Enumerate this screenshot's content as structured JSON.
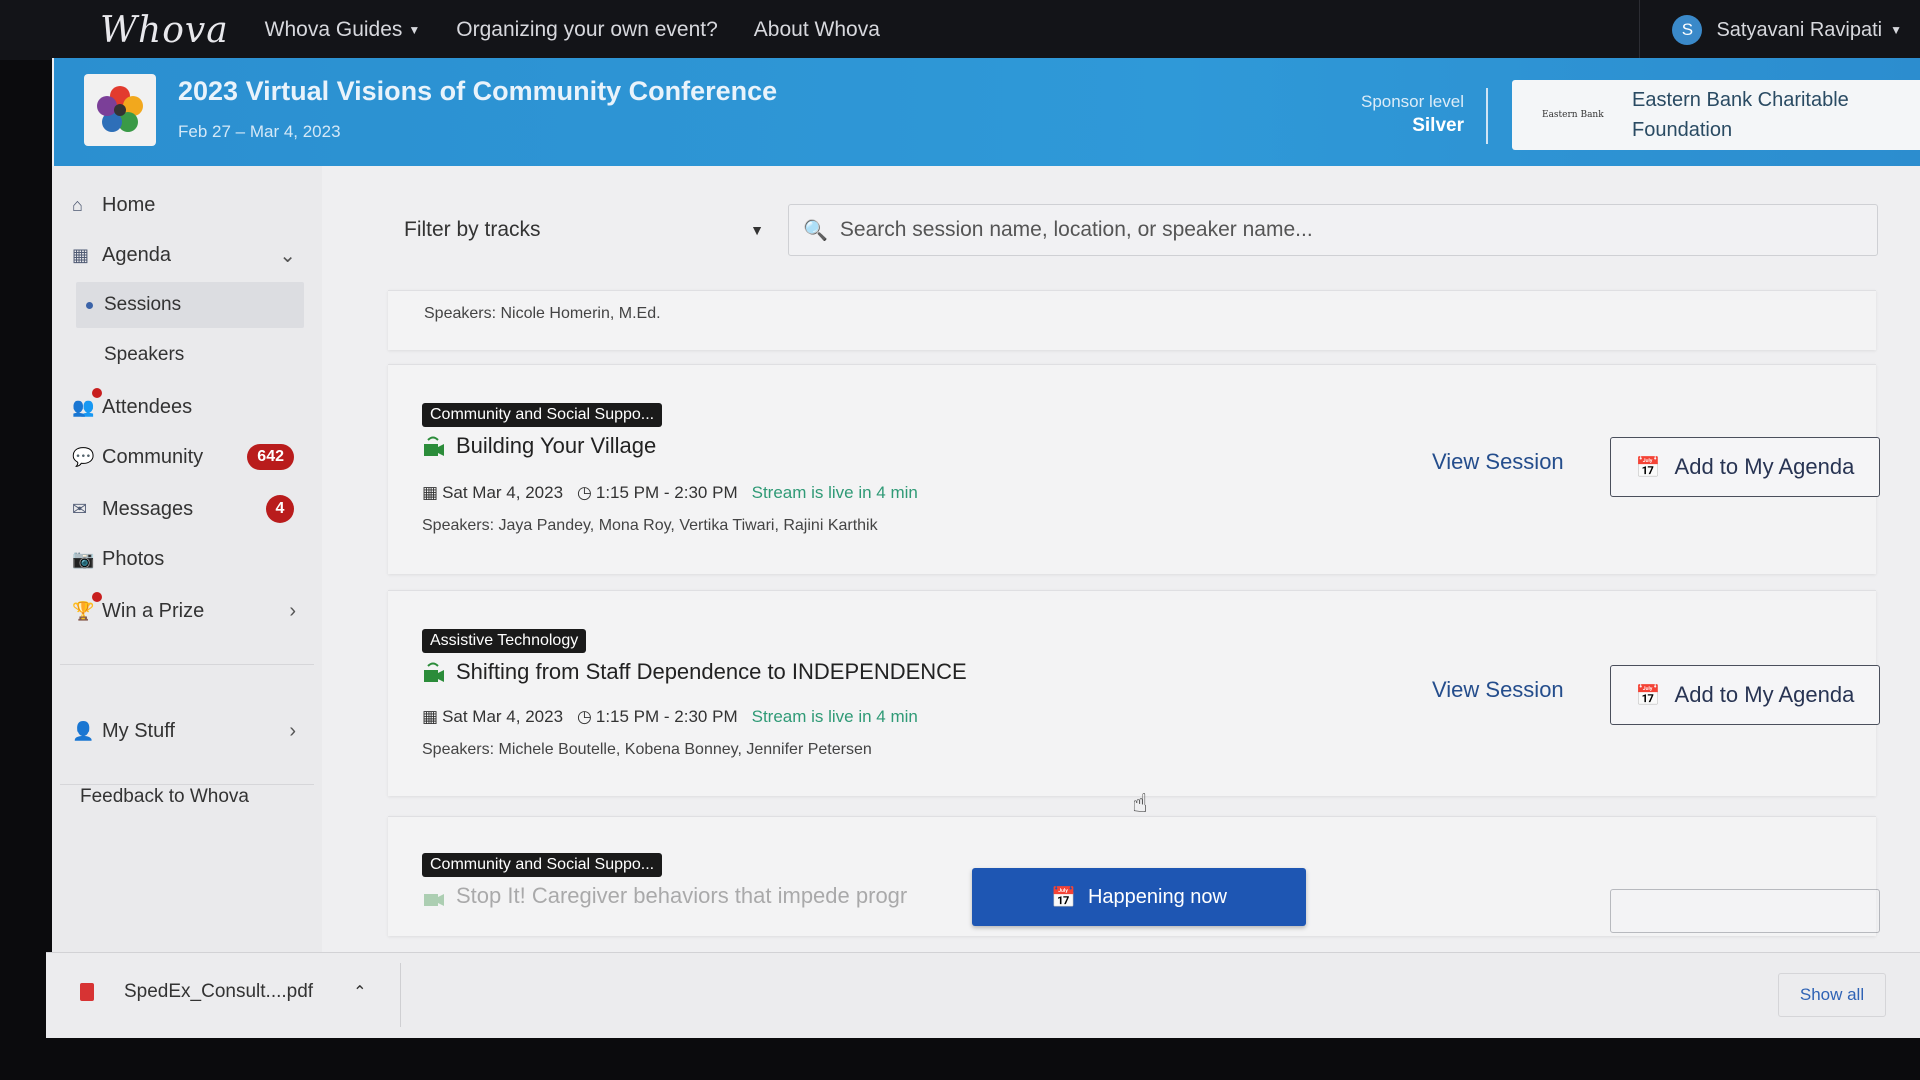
{
  "topnav": {
    "logo": "Whova",
    "links": [
      "Whova Guides",
      "Organizing your own event?",
      "About Whova"
    ],
    "user_initial": "S",
    "user_name": "Satyavani Ravipati"
  },
  "event": {
    "title": "2023 Virtual Visions of Community Conference",
    "dates": "Feb 27 – Mar 4, 2023",
    "sponsor_level_label": "Sponsor level",
    "sponsor_level": "Silver",
    "sponsor_logo_text": "Eastern Bank",
    "sponsor_name_line1": "Eastern Bank Charitable",
    "sponsor_name_line2": "Foundation"
  },
  "sidebar": {
    "items": [
      {
        "label": "Home"
      },
      {
        "label": "Agenda"
      },
      {
        "label": "Sessions"
      },
      {
        "label": "Speakers"
      },
      {
        "label": "Attendees"
      },
      {
        "label": "Community",
        "badge": "642"
      },
      {
        "label": "Messages",
        "badge": "4"
      },
      {
        "label": "Photos"
      },
      {
        "label": "Win a Prize"
      },
      {
        "label": "My Stuff"
      }
    ],
    "feedback": "Feedback to Whova"
  },
  "filters": {
    "tracks_label": "Filter by tracks",
    "search_placeholder": "Search session name, location, or speaker name..."
  },
  "sessions": [
    {
      "speakers": "Speakers: Nicole Homerin, M.Ed."
    },
    {
      "track": "Community and Social Suppo...",
      "title": "Building Your Village",
      "date": "Sat Mar 4, 2023",
      "time": "1:15 PM - 2:30 PM",
      "status": "Stream is live in 4 min",
      "speakers": "Speakers: Jaya Pandey, Mona Roy, Vertika Tiwari, Rajini Karthik",
      "view_label": "View Session",
      "add_label": "Add to My Agenda"
    },
    {
      "track": "Assistive Technology",
      "title": "Shifting from Staff Dependence to INDEPENDENCE",
      "date": "Sat Mar 4, 2023",
      "time": "1:15 PM - 2:30 PM",
      "status": "Stream is live in 4 min",
      "speakers": "Speakers: Michele Boutelle, Kobena Bonney, Jennifer Petersen",
      "view_label": "View Session",
      "add_label": "Add to My Agenda"
    },
    {
      "track": "Community and Social Suppo...",
      "title": "Stop It! Caregiver behaviors that impede progr"
    }
  ],
  "happening_now": "Happening now",
  "downloads": {
    "file": "SpedEx_Consult....pdf",
    "show_all": "Show all"
  },
  "colors": {
    "banner": "#2f99d8",
    "badge": "#b91c1c",
    "live": "#2f9a76",
    "primary": "#1e56b3"
  }
}
